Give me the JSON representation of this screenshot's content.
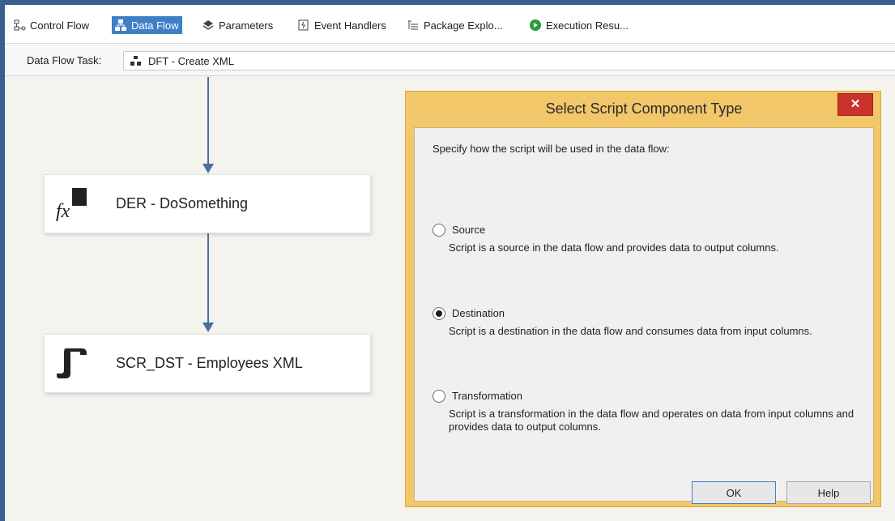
{
  "tabs": [
    {
      "label": "Control Flow",
      "icon": "control-flow-icon",
      "active": false
    },
    {
      "label": "Data Flow",
      "icon": "data-flow-icon",
      "active": true
    },
    {
      "label": "Parameters",
      "icon": "parameters-icon",
      "active": false
    },
    {
      "label": "Event Handlers",
      "icon": "event-handlers-icon",
      "active": false
    },
    {
      "label": "Package Explo...",
      "icon": "package-explorer-icon",
      "active": false
    },
    {
      "label": "Execution Resu...",
      "icon": "execution-results-icon",
      "active": false
    }
  ],
  "task": {
    "label": "Data Flow Task:",
    "value": "DFT - Create XML"
  },
  "components": [
    {
      "label": "DER - DoSomething",
      "icon": "derived-column-icon"
    },
    {
      "label": "SCR_DST - Employees XML",
      "icon": "script-component-icon"
    }
  ],
  "dialog": {
    "title": "Select Script Component Type",
    "close": "✕",
    "prompt": "Specify how the script will be used in the data flow:",
    "options": [
      {
        "label": "Source",
        "description": "Script is a source in the data flow and provides data to output columns.",
        "checked": false
      },
      {
        "label": "Destination",
        "description": "Script is a destination in the data flow and consumes data from input columns.",
        "checked": true
      },
      {
        "label": "Transformation",
        "description": "Script is a transformation in the data flow and operates on data from input columns and provides data to output columns.",
        "checked": false
      }
    ],
    "ok": "OK",
    "help": "Help"
  },
  "colors": {
    "active_tab": "#3f7fc6",
    "dialog_frame": "#f1c76a",
    "close_button": "#c8322b",
    "arrow": "#4a6f9e"
  }
}
